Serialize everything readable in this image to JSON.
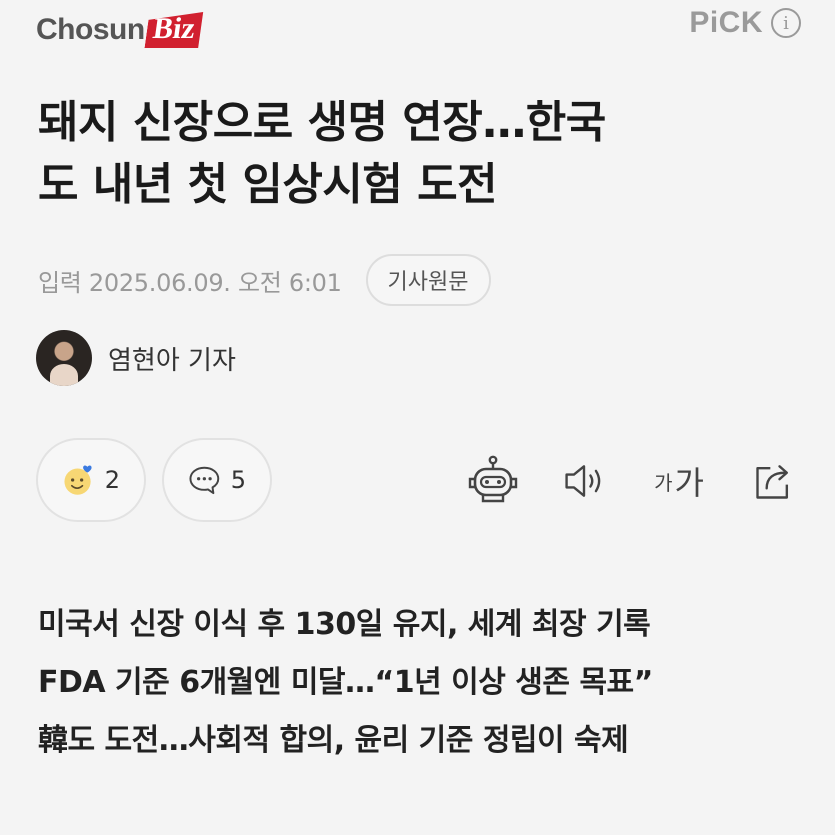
{
  "header": {
    "logo_main": "Chosun",
    "logo_accent": "Biz",
    "pick_label": "PiCK",
    "info_symbol": "i"
  },
  "article": {
    "headline_line1": "돼지 신장으로 생명 연장…한국",
    "headline_line2": "도 내년 첫 임상시험 도전",
    "date": "입력 2025.06.09. 오전 6:01",
    "original_button": "기사원문",
    "author": "염현아 기자",
    "summary": [
      "미국서 신장 이식 후 130일 유지, 세계 최장 기록",
      "FDA 기준 6개월엔 미달…“1년 이상 생존 목표”",
      "韓도 도전…사회적 합의, 윤리 기준 정립이 숙제"
    ]
  },
  "reactions": {
    "emoji_count": "2",
    "comment_count": "5"
  },
  "toolbar": {
    "font_small": "가",
    "font_large": "가",
    "icons": [
      "robot-icon",
      "speaker-icon",
      "font-size-icon",
      "share-icon"
    ]
  },
  "colors": {
    "brand_red": "#d1202f",
    "background": "#f4f4f4"
  }
}
